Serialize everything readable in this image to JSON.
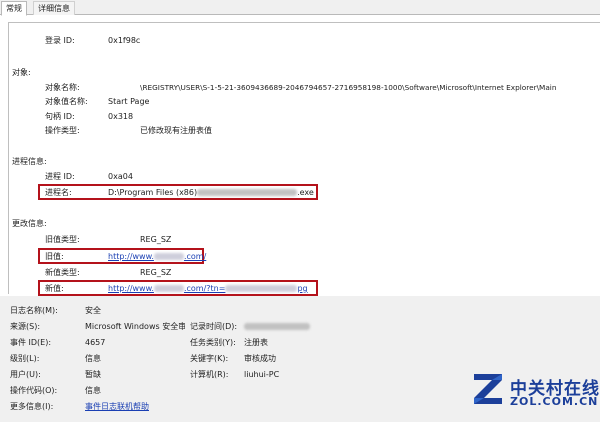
{
  "tabs": {
    "general": "常规",
    "details": "详细信息"
  },
  "login": {
    "label": "登录 ID:",
    "value": "0x1f98c"
  },
  "object": {
    "section": "对象:",
    "name_label": "对象名称:",
    "name_value": "\\REGISTRY\\USER\\S-1-5-21-3609436689-2046794657-2716958198-1000\\Software\\Microsoft\\Internet Explorer\\Main",
    "value_name_label": "对象值名称:",
    "value_name_value": "Start Page",
    "handle_label": "句柄 ID:",
    "handle_value": "0x318",
    "op_label": "操作类型:",
    "op_value": "已修改现有注册表值"
  },
  "process": {
    "section": "进程信息:",
    "id_label": "进程 ID:",
    "id_value": "0xa04",
    "name_label": "进程名:",
    "name_prefix": "D:\\Program Files (x86)",
    "name_suffix": ".exe"
  },
  "change": {
    "section": "更改信息:",
    "old_type_label": "旧值类型:",
    "old_type_value": "REG_SZ",
    "old_label": "旧值:",
    "old_prefix": "http://www.",
    "old_suffix": ".com/",
    "new_type_label": "新值类型:",
    "new_type_value": "REG_SZ",
    "new_label": "新值:",
    "new_prefix": "http://www.",
    "new_mid": ".com/?tn=",
    "new_suffix": "pg"
  },
  "footer": {
    "log_name_label": "日志名称(M):",
    "log_name_value": "安全",
    "source_label": "来源(S):",
    "source_value": "Microsoft Windows 安全审",
    "logged_label": "记录时间(D):",
    "event_id_label": "事件 ID(E):",
    "event_id_value": "4657",
    "task_label": "任务类别(Y):",
    "task_value": "注册表",
    "level_label": "级别(L):",
    "level_value": "信息",
    "keywords_label": "关键字(K):",
    "keywords_value": "审核成功",
    "user_label": "用户(U):",
    "user_value": "暂缺",
    "computer_label": "计算机(R):",
    "computer_value": "liuhui-PC",
    "opcode_label": "操作代码(O):",
    "opcode_value": "信息",
    "more_label": "更多信息(I):",
    "more_link": "事件日志联机帮助"
  },
  "watermark": {
    "cn": "中关村在线",
    "en": "ZOL.COM.CN"
  },
  "colors": {
    "highlight": "#b4121b",
    "link": "#1a3fb3",
    "logo": "#1c3f9a"
  }
}
